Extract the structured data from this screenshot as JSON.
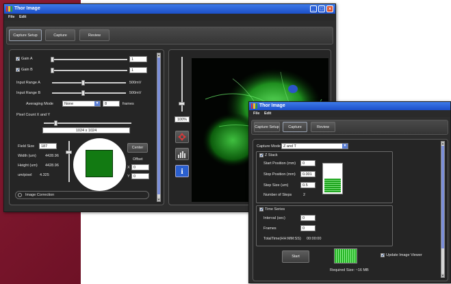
{
  "colors": {
    "accent_green": "#1aa31a",
    "titlebar_blue": "#1c4fc8",
    "background_maroon": "#7a1530"
  },
  "app_title": "Thor Image",
  "menu": {
    "file": "File",
    "edit": "Edit"
  },
  "tabs": {
    "capture_setup": "Capture Setup",
    "capture": "Capture",
    "review": "Review"
  },
  "main": {
    "gain_a_label": "Gain A",
    "gain_a_value": "1",
    "gain_b_label": "Gain B",
    "gain_b_value": "1",
    "input_range_a_label": "Input Range A",
    "input_range_a_value": "500mV",
    "input_range_b_label": "Input Range B",
    "input_range_b_value": "500mV",
    "averaging_mode_label": "Averaging Mode",
    "averaging_mode_value": "None",
    "frames_value": "8",
    "frames_label": "frames",
    "pixel_count_label": "Pixel Count X and Y",
    "pixel_count_value": "1024 x 1024",
    "field_size_label": "Field Size",
    "field_size_value": "187",
    "width_label": "Width (um)",
    "width_value": "4428.96",
    "height_label": "Height (um)",
    "height_value": "4428.96",
    "um_pixel_label": "um/pixel",
    "um_pixel_value": "4.325",
    "center_button": "Center",
    "offset_label": "Offset",
    "offset_x_label": "X",
    "offset_x_value": "0",
    "offset_y_label": "Y",
    "offset_y_value": "0",
    "image_correction": "Image Correction",
    "zoom_value": "100%"
  },
  "capture": {
    "capture_mode_label": "Capture Mode",
    "capture_mode_value": "Z and T",
    "z_stack_label": "Z Stack",
    "start_position_label": "Start Position (mm)",
    "start_position_value": "0",
    "stop_position_label": "Stop Position (mm)",
    "stop_position_value": "0.001",
    "step_size_label": "Step Size (um)",
    "step_size_value": "0.5",
    "num_steps_label": "Number of Steps",
    "num_steps_value": "2",
    "time_series_label": "Time Series",
    "interval_label": "Interval (sec)",
    "interval_value": "0",
    "frames_label": "Frames",
    "frames_value": "0",
    "total_time_label": "TotalTime(HH:MM:SS)",
    "total_time_value": "00:00:00",
    "start_button": "Start",
    "update_viewer_label": "Update Image Viewer",
    "required_size": "Required Size: ~16 MB"
  }
}
